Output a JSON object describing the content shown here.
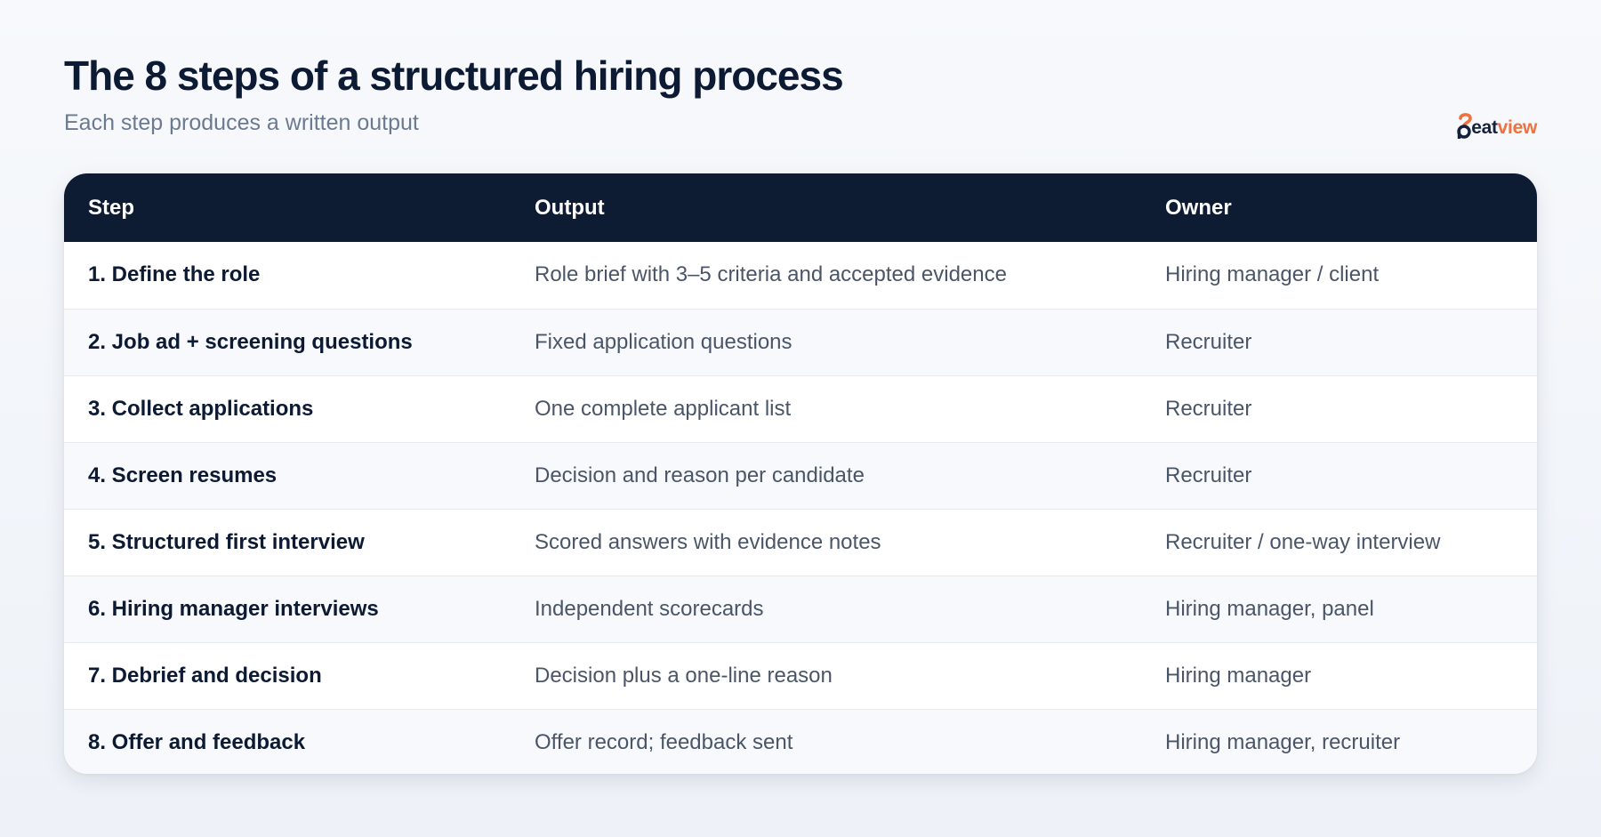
{
  "header": {
    "title": "The 8 steps of a structured hiring process",
    "subtitle": "Each step produces a written output"
  },
  "logo": {
    "text_part1": "eat",
    "text_part2": "view",
    "icon": "hirebeat-logo-mark",
    "colors": {
      "dark": "#14213d",
      "accent": "#f0703e"
    }
  },
  "table": {
    "columns": [
      "Step",
      "Output",
      "Owner"
    ],
    "rows": [
      {
        "step": "1. Define the role",
        "output": "Role brief with 3–5 criteria and accepted evidence",
        "owner": "Hiring manager / client"
      },
      {
        "step": "2. Job ad + screening questions",
        "output": "Fixed application questions",
        "owner": "Recruiter"
      },
      {
        "step": "3. Collect applications",
        "output": "One complete applicant list",
        "owner": "Recruiter"
      },
      {
        "step": "4. Screen resumes",
        "output": "Decision and reason per candidate",
        "owner": "Recruiter"
      },
      {
        "step": "5. Structured first interview",
        "output": "Scored answers with evidence notes",
        "owner": "Recruiter / one-way interview"
      },
      {
        "step": "6. Hiring manager interviews",
        "output": "Independent scorecards",
        "owner": "Hiring manager, panel"
      },
      {
        "step": "7. Debrief and decision",
        "output": "Decision plus a one-line reason",
        "owner": "Hiring manager"
      },
      {
        "step": "8. Offer and feedback",
        "output": "Offer record; feedback sent",
        "owner": "Hiring manager, recruiter"
      }
    ]
  },
  "colors": {
    "header_bg": "#0d1b33",
    "title": "#0c1a33",
    "subtitle": "#6b7a90",
    "row_alt": "#f7f9fc"
  }
}
